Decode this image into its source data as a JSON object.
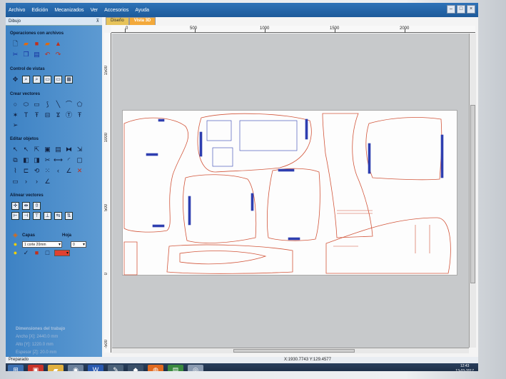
{
  "menubar": {
    "items": [
      "Archivo",
      "Edición",
      "Mecanizados",
      "Ver",
      "Accesorios",
      "Ayuda"
    ]
  },
  "panel": {
    "title": "Dibujo",
    "sections": {
      "file_ops": "Operaciones con archivos",
      "view_control": "Control de vistas",
      "create_vectors": "Crear vectores",
      "edit_objects": "Editar objetos",
      "align_vectors": "Alinear vectores"
    },
    "layers_label": "Capas",
    "sheet_label": "Hoja",
    "layer_value": "1 corte 20mm",
    "sheet_value": "0",
    "job_dimensions": {
      "heading": "Dimensiones del trabajo",
      "width": "Ancho   [X]: 2440.0 mm",
      "height": "Alto    [Y]: 1220.0 mm",
      "thickness": "Espesor [Z]: 20.0 mm"
    }
  },
  "tabs": [
    "Diseño",
    "Vista 3D"
  ],
  "ruler": {
    "h_labels": [
      "0",
      "500",
      "1000",
      "1500",
      "2000"
    ],
    "v_labels": [
      "1500",
      "1000",
      "500",
      "0",
      "-500"
    ]
  },
  "status": {
    "left": "Preparado",
    "coords": "X:1930.7743 Y:129.4577"
  },
  "clock": {
    "time": "12:43",
    "date": "13-03-2017"
  },
  "colors": {
    "accent_orange": "#f3a93a",
    "panel_blue": "#3d82c4",
    "toolpath_red": "#d2553a",
    "toolpath_blue": "#2f3fb0"
  }
}
